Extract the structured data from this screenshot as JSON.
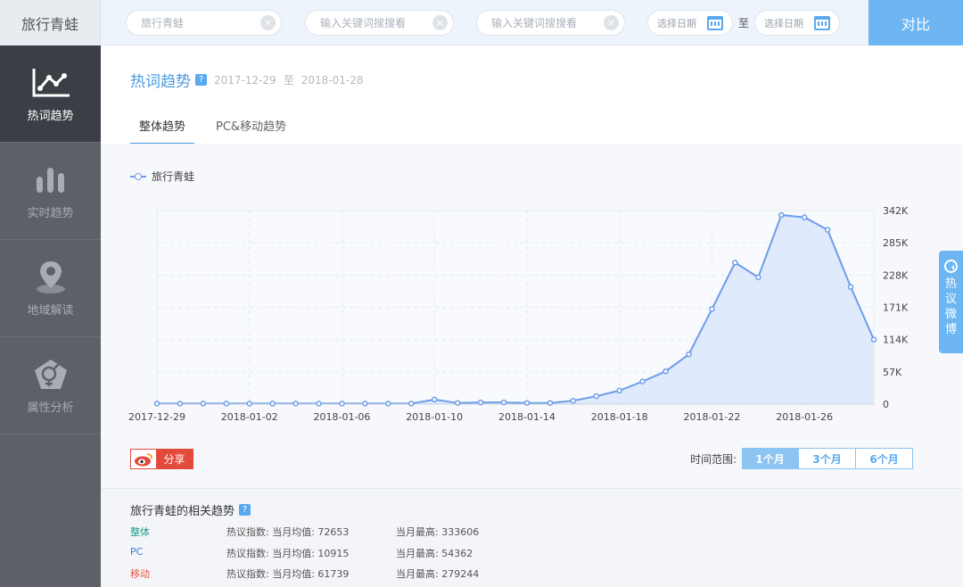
{
  "brand": "旅行青蛙",
  "search": [
    {
      "value": "旅行青蛙",
      "placeholder": "",
      "filled": true
    },
    {
      "value": "",
      "placeholder": "输入关键词搜搜看",
      "filled": false
    },
    {
      "value": "",
      "placeholder": "输入关键词搜搜看",
      "filled": false
    }
  ],
  "date": {
    "start_placeholder": "选择日期",
    "to": "至",
    "end_placeholder": "选择日期"
  },
  "compare_label": "对比",
  "sidebar": {
    "items": [
      {
        "label": "热词趋势",
        "icon": "line-chart-icon",
        "active": true
      },
      {
        "label": "实时趋势",
        "icon": "bar-chart-icon",
        "active": false
      },
      {
        "label": "地域解读",
        "icon": "location-pin-icon",
        "active": false
      },
      {
        "label": "属性分析",
        "icon": "gender-icon",
        "active": false
      }
    ]
  },
  "page": {
    "title": "热词趋势",
    "help": "?",
    "range_start": "2017-12-29",
    "range_sep": "至",
    "range_end": "2018-01-28"
  },
  "tabs": [
    {
      "label": "整体趋势",
      "active": true
    },
    {
      "label": "PC&移动趋势",
      "active": false
    }
  ],
  "colors": {
    "accent": "#4a9be0",
    "line": "#6d9de8",
    "fill": "#dbe8fb",
    "share": "#e24b3b"
  },
  "chart_data": {
    "type": "area",
    "series": [
      {
        "name": "旅行青蛙",
        "values": [
          1000,
          1000,
          1000,
          1000,
          1000,
          1000,
          1000,
          1000,
          1000,
          1000,
          1000,
          1000,
          8000,
          2000,
          3000,
          3000,
          2000,
          2000,
          6000,
          14000,
          24000,
          40000,
          58000,
          88000,
          168000,
          250000,
          224000,
          334000,
          330000,
          308000,
          207000,
          114000
        ]
      }
    ],
    "x": [
      "2017-12-29",
      "2017-12-30",
      "2017-12-31",
      "2018-01-01",
      "2018-01-02",
      "2018-01-03",
      "2018-01-04",
      "2018-01-05",
      "2018-01-06",
      "2018-01-07",
      "2018-01-08",
      "2018-01-09",
      "2018-01-10",
      "2018-01-11",
      "2018-01-12",
      "2018-01-13",
      "2018-01-14",
      "2018-01-15",
      "2018-01-16",
      "2018-01-17",
      "2018-01-18",
      "2018-01-19",
      "2018-01-20",
      "2018-01-21",
      "2018-01-22",
      "2018-01-23",
      "2018-01-24",
      "2018-01-25",
      "2018-01-26",
      "2018-01-27",
      "2018-01-28",
      "2018-01-29"
    ],
    "xticks": [
      "2017-12-29",
      "2018-01-02",
      "2018-01-06",
      "2018-01-10",
      "2018-01-14",
      "2018-01-18",
      "2018-01-22",
      "2018-01-26"
    ],
    "yticks": [
      "0",
      "57K",
      "114K",
      "171K",
      "228K",
      "285K",
      "342K"
    ],
    "ylim": [
      0,
      342000
    ],
    "ytick_values": [
      0,
      57000,
      114000,
      171000,
      228000,
      285000,
      342000
    ],
    "grid": true,
    "legend": "top-left"
  },
  "share_label": "分享",
  "range": {
    "label": "时间范围:",
    "options": [
      {
        "label": "1个月",
        "active": true
      },
      {
        "label": "3个月",
        "active": false
      },
      {
        "label": "6个月",
        "active": false
      }
    ]
  },
  "related": {
    "title": "旅行青蛙的相关趋势",
    "help": "?",
    "rows": [
      {
        "name": "整体",
        "color": "#1a9f8d",
        "avg": "热议指数: 当月均值: 72653",
        "max": "当月最高: 333606"
      },
      {
        "name": "PC",
        "color": "#3a7ecf",
        "avg": "热议指数: 当月均值: 10915",
        "max": "当月最高: 54362"
      },
      {
        "name": "移动",
        "color": "#e4553f",
        "avg": "热议指数: 当月均值: 61739",
        "max": "当月最高: 279244"
      }
    ]
  },
  "weibo_tab": "热议微博"
}
